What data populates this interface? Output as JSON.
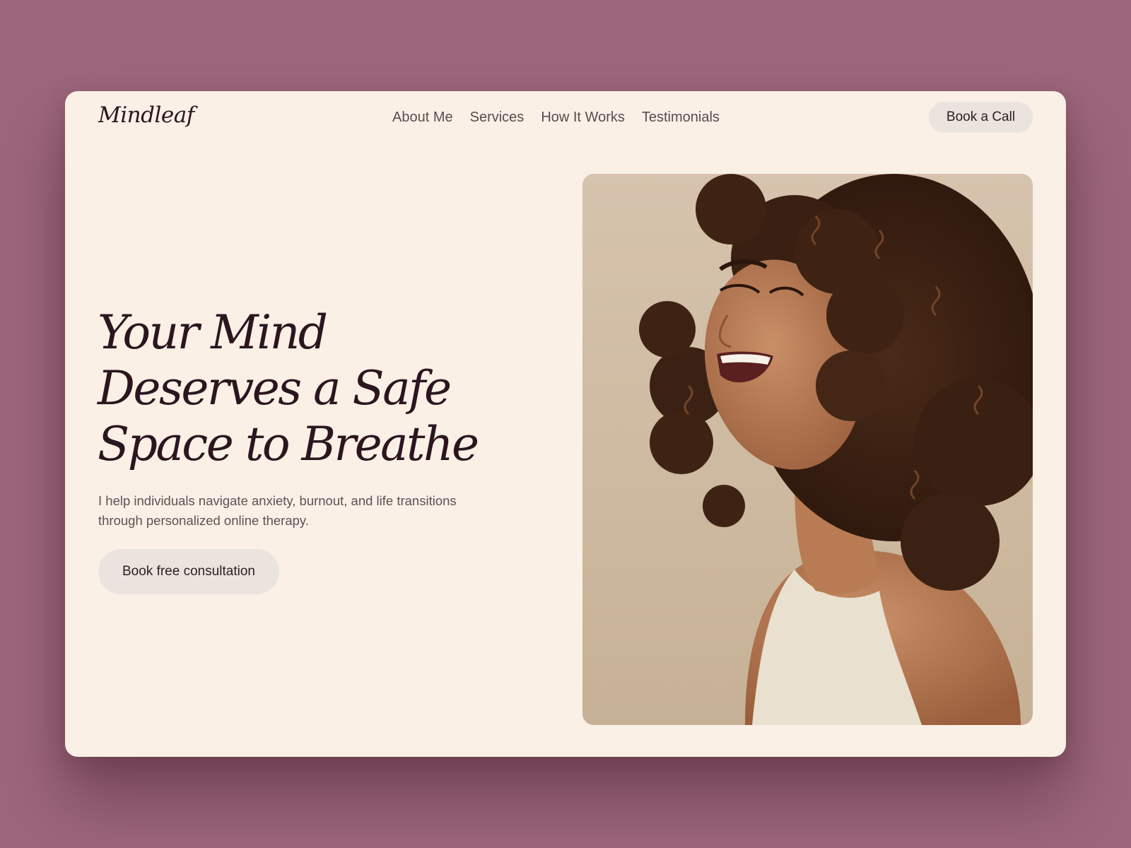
{
  "brand": {
    "logo": "Mindleaf"
  },
  "nav": {
    "items": [
      {
        "label": "About Me"
      },
      {
        "label": "Services"
      },
      {
        "label": "How It Works"
      },
      {
        "label": "Testimonials"
      }
    ],
    "cta_label": "Book a Call"
  },
  "hero": {
    "headline_lines": [
      "Your Mind",
      "Deserves a Safe",
      "Space to Breathe"
    ],
    "subtext": "I help individuals navigate anxiety, burnout, and life transitions through personalized online therapy.",
    "cta_label": "Book free consultation",
    "image_alt": "Smiling woman with curly hair"
  },
  "colors": {
    "backdrop": "#9c667c",
    "card": "#faf0e5",
    "text_dark": "#2b1620",
    "button_bg": "#ebe4de"
  }
}
